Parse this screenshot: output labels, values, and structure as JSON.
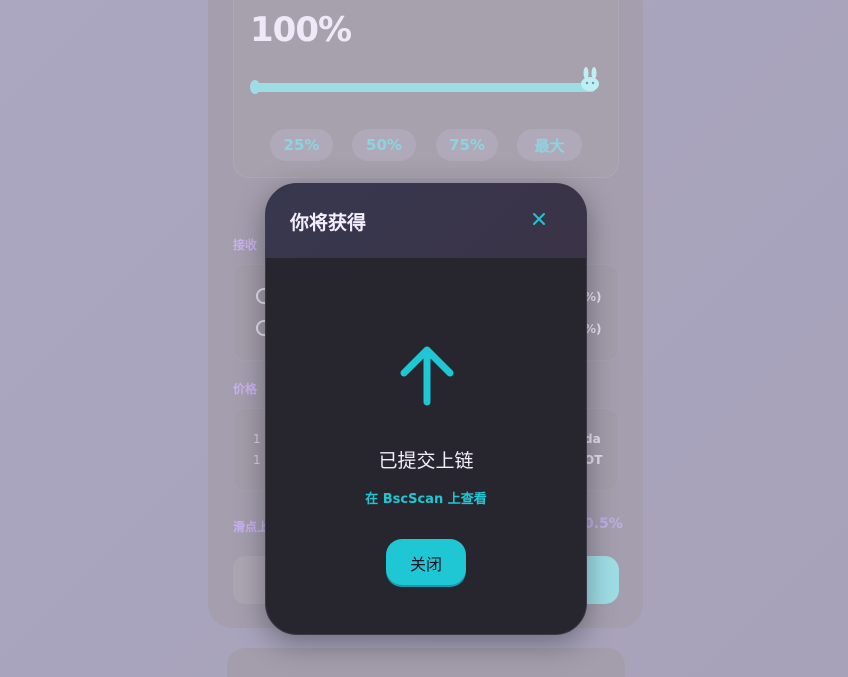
{
  "background_form": {
    "amount_percent": "100%",
    "slider_value": 1.0,
    "quick_buttons": [
      "25%",
      "50%",
      "75%",
      "最大"
    ],
    "receive_label": "接收",
    "receive_rows": [
      {
        "suffix": "%)"
      },
      {
        "suffix": "%)"
      }
    ],
    "price_label": "价格",
    "price_rows": [
      {
        "left": "1 U",
        "right": "da"
      },
      {
        "left": "1 I",
        "right": "OT"
      }
    ],
    "slippage_label": "滑点上",
    "slippage_value": "0.5%"
  },
  "modal": {
    "title": "你将获得",
    "close_icon": "close-icon",
    "status_icon": "arrow-up-icon",
    "status_text": "已提交上链",
    "explorer_link": "在 BscScan 上查看",
    "close_button_label": "关闭"
  },
  "colors": {
    "accent": "#1fc7d4",
    "modal_bg": "#27262e",
    "text_primary": "#f4eefc"
  }
}
